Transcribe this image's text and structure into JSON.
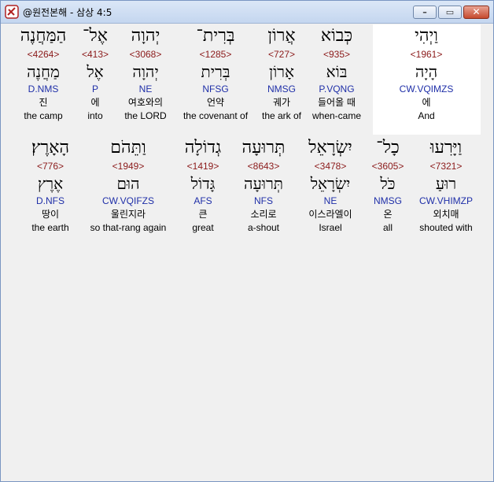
{
  "window": {
    "title": "@원전본해 - 삼상 4:5"
  },
  "line1": [
    {
      "hebrew": "וַיְהִי",
      "strong": "<1961>",
      "lemma": "הָיָה",
      "parse": "CW.VQIMZS",
      "korean": "에",
      "english": "And"
    },
    {
      "hebrew": "כְּבוֹא",
      "strong": "<935>",
      "lemma": "בּוֹא",
      "parse": "P.VQNG",
      "korean": "들어올 때",
      "english": "when-came"
    },
    {
      "hebrew": "אֲרוֹן",
      "strong": "<727>",
      "lemma": "אָרוֹן",
      "parse": "NMSG",
      "korean": "궤가",
      "english": "the ark of"
    },
    {
      "hebrew": "בְּרִית־",
      "strong": "<1285>",
      "lemma": "בְּרִית",
      "parse": "NFSG",
      "korean": "언약",
      "english": "the covenant of"
    },
    {
      "hebrew": "יְהוָה",
      "strong": "<3068>",
      "lemma": "יְהוָה",
      "parse": "NE",
      "korean": "여호와의",
      "english": "the LORD"
    },
    {
      "hebrew": "אֶל־",
      "strong": "<413>",
      "lemma": "אֶל",
      "parse": "P",
      "korean": "에",
      "english": "into"
    },
    {
      "hebrew": "הַמַּחֲנֶה",
      "strong": "<4264>",
      "lemma": "מַחֲנֶה",
      "parse": "D.NMS",
      "korean": "진",
      "english": "the camp"
    }
  ],
  "line2": [
    {
      "hebrew": "וַיָּרִעוּ",
      "strong": "<7321>",
      "lemma": "רוּעַ",
      "parse": "CW.VHIMZP",
      "korean": "외치매",
      "english": "shouted with"
    },
    {
      "hebrew": "כָל־",
      "strong": "<3605>",
      "lemma": "כֹּל",
      "parse": "NMSG",
      "korean": "온",
      "english": "all"
    },
    {
      "hebrew": "יִשְׂרָאֵל",
      "strong": "<3478>",
      "lemma": "יִשְׂרָאֵל",
      "parse": "NE",
      "korean": "이스라엘이",
      "english": "Israel"
    },
    {
      "hebrew": "תְּרוּעָה",
      "strong": "<8643>",
      "lemma": "תְּרוּעָה",
      "parse": "NFS",
      "korean": "소리로",
      "english": "a-shout"
    },
    {
      "hebrew": "גְדוֹלָה",
      "strong": "<1419>",
      "lemma": "גָּדוֹל",
      "parse": "AFS",
      "korean": "큰",
      "english": "great"
    },
    {
      "hebrew": "וַתֵּהֹם",
      "strong": "<1949>",
      "lemma": "הוּם",
      "parse": "CW.VQIFZS",
      "korean": "울린지라",
      "english": "so that-rang again"
    },
    {
      "hebrew": "הָאָרֶץ׃",
      "strong": "<776>",
      "lemma": "אֶרֶץ",
      "parse": "D.NFS",
      "korean": "땅이",
      "english": "the earth"
    }
  ]
}
